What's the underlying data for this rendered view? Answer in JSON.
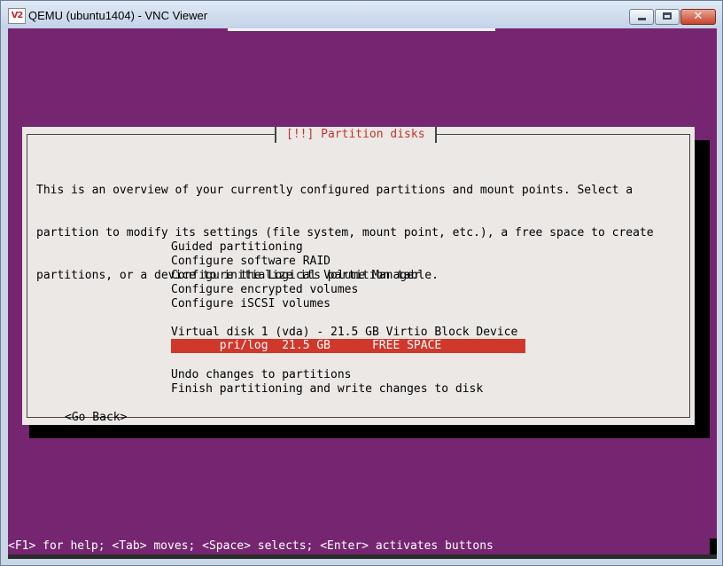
{
  "window": {
    "title": "QEMU (ubuntu1404) - VNC Viewer",
    "icon_text": "V2",
    "close_glyph": "✕"
  },
  "dialog": {
    "title": "[!!] Partition disks",
    "intro_lines": [
      "This is an overview of your currently configured partitions and mount points. Select a",
      "partition to modify its settings (file system, mount point, etc.), a free space to create",
      "partitions, or a device to initialize its partition table."
    ],
    "menu_items": [
      "Guided partitioning",
      "Configure software RAID",
      "Configure the Logical Volume Manager",
      "Configure encrypted volumes",
      "Configure iSCSI volumes"
    ],
    "disk_label": "Virtual disk 1 (vda) - 21.5 GB Virtio Block Device",
    "selected_partition": "       pri/log  21.5 GB      FREE SPACE",
    "actions": [
      "Undo changes to partitions",
      "Finish partitioning and write changes to disk"
    ],
    "go_back": "<Go Back>"
  },
  "status_bar": {
    "text": "<F1> for help; <Tab> moves; <Space> selects; <Enter> activates buttons"
  }
}
